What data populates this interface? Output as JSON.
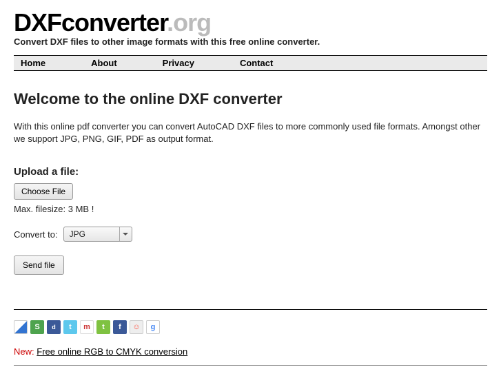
{
  "logo": {
    "main": "DXFconverter",
    "tld": ".org"
  },
  "tagline": "Convert DXF files to other image formats with this free online converter.",
  "nav": {
    "home": "Home",
    "about": "About",
    "privacy": "Privacy",
    "contact": "Contact"
  },
  "heading": "Welcome to the online DXF converter",
  "intro": "With this online pdf converter you can convert AutoCAD DXF files to more commonly used file formats. Amongst other we support JPG, PNG, GIF, PDF as output format.",
  "upload": {
    "label": "Upload a file:",
    "choose": "Choose File",
    "maxsize": "Max. filesize: 3 MB !",
    "convert_to": "Convert to:",
    "selected_format": "JPG",
    "send": "Send file"
  },
  "footer": {
    "new_label": "New:",
    "new_link": "Free online RGB to CMYK conversion"
  }
}
